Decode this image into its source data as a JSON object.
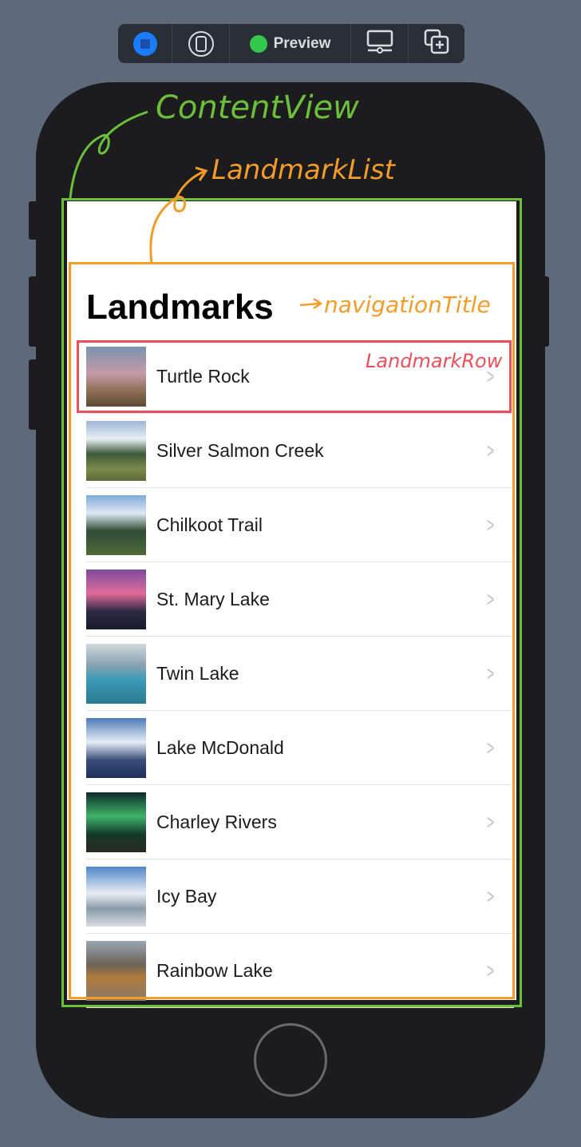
{
  "toolbar": {
    "items": [
      {
        "icon": "live-mode-icon"
      },
      {
        "icon": "device-settings-icon"
      },
      {
        "icon": "preview-status-dot",
        "label": "Preview"
      },
      {
        "icon": "device-display-icon"
      },
      {
        "icon": "duplicate-preview-icon"
      }
    ],
    "status_color": "#34c84a",
    "accent": "#1a7cff"
  },
  "annotations": {
    "content_view": "ContentView",
    "landmark_list": "LandmarkList",
    "navigation_title": "navigationTitle",
    "landmark_row": "LandmarkRow",
    "colors": {
      "content_view": "#6cbf3a",
      "landmark_list": "#f39c2c",
      "landmark_row": "#e8505b"
    }
  },
  "screen": {
    "title": "Landmarks",
    "rows": [
      {
        "name": "Turtle Rock"
      },
      {
        "name": "Silver Salmon Creek"
      },
      {
        "name": "Chilkoot Trail"
      },
      {
        "name": "St. Mary Lake"
      },
      {
        "name": "Twin Lake"
      },
      {
        "name": "Lake McDonald"
      },
      {
        "name": "Charley Rivers"
      },
      {
        "name": "Icy Bay"
      },
      {
        "name": "Rainbow Lake"
      }
    ]
  }
}
